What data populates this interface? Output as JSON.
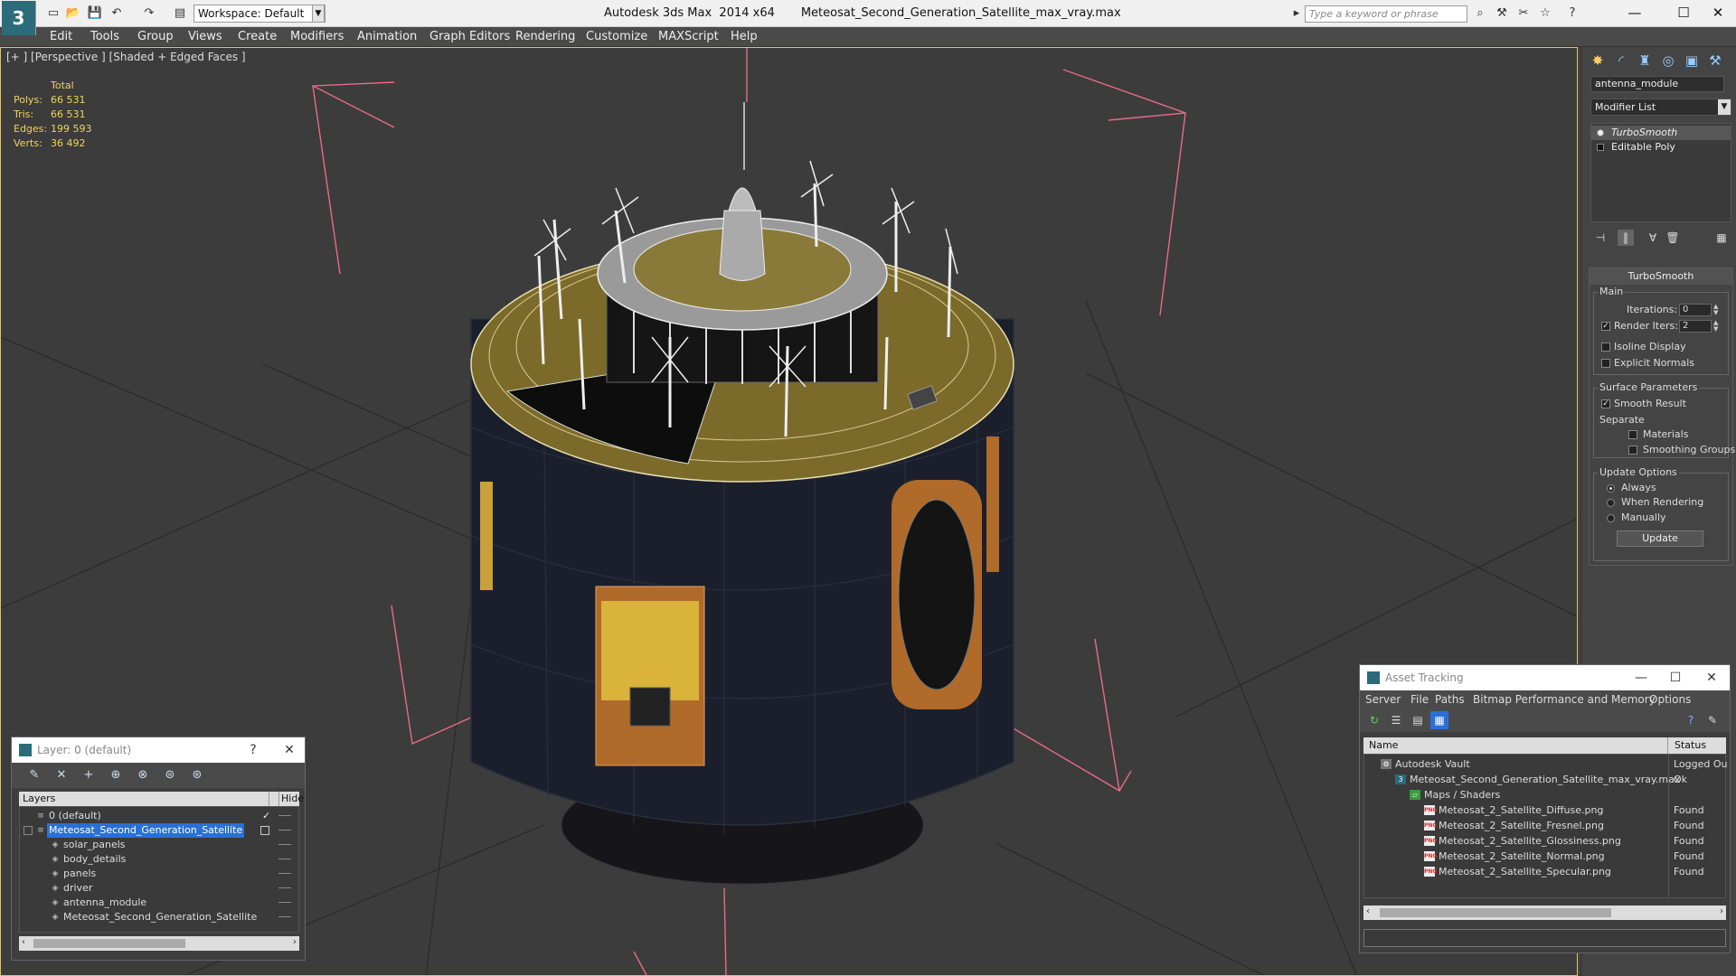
{
  "titlebar": {
    "app_logo": "3",
    "workspace": "Workspace: Default",
    "title": "Autodesk 3ds Max  2014 x64       Meteosat_Second_Generation_Satellite_max_vray.max",
    "search_placeholder": "Type a keyword or phrase",
    "minimize": "—",
    "maximize": "☐",
    "close": "✕"
  },
  "menu": [
    "Edit",
    "Tools",
    "Group",
    "Views",
    "Create",
    "Modifiers",
    "Animation",
    "Graph Editors",
    "Rendering",
    "Customize",
    "MAXScript",
    "Help"
  ],
  "viewport": {
    "label": "[+ ] [Perspective ] [Shaded + Edged Faces ]",
    "stats_header": "Total",
    "stats": [
      {
        "label": "Polys:",
        "value": "66 531"
      },
      {
        "label": "Tris:",
        "value": "66 531"
      },
      {
        "label": "Edges:",
        "value": "199 593"
      },
      {
        "label": "Verts:",
        "value": "36 492"
      }
    ]
  },
  "command_panel": {
    "object_name": "antenna_module",
    "modifier_list": "Modifier List",
    "stack": [
      {
        "label": "TurboSmooth",
        "selected": true
      },
      {
        "label": "Editable Poly",
        "selected": false
      }
    ],
    "rollout_title": "TurboSmooth",
    "main_group": "Main",
    "iterations_label": "Iterations:",
    "iterations_value": "0",
    "render_iters_label": "Render Iters:",
    "render_iters_value": "2",
    "isoline_label": "Isoline Display",
    "explicit_normals_label": "Explicit Normals",
    "surface_group": "Surface Parameters",
    "smooth_result_label": "Smooth Result",
    "separate_label": "Separate",
    "materials_label": "Materials",
    "smoothing_groups_label": "Smoothing Groups",
    "update_group": "Update Options",
    "always_label": "Always",
    "when_rendering_label": "When Rendering",
    "manually_label": "Manually",
    "update_button": "Update"
  },
  "layer_dialog": {
    "title": "Layer: 0 (default)",
    "help": "?",
    "close": "✕",
    "col_layers": "Layers",
    "col_hide": "Hide",
    "rows": [
      {
        "name": "0 (default)",
        "indent": 1,
        "selected": false,
        "check": "✓"
      },
      {
        "name": "Meteosat_Second_Generation_Satellite",
        "indent": 1,
        "selected": true,
        "check": ""
      },
      {
        "name": "solar_panels",
        "indent": 2,
        "selected": false,
        "check": ""
      },
      {
        "name": "body_details",
        "indent": 2,
        "selected": false,
        "check": ""
      },
      {
        "name": "panels",
        "indent": 2,
        "selected": false,
        "check": ""
      },
      {
        "name": "driver",
        "indent": 2,
        "selected": false,
        "check": ""
      },
      {
        "name": "antenna_module",
        "indent": 2,
        "selected": false,
        "check": ""
      },
      {
        "name": "Meteosat_Second_Generation_Satellite",
        "indent": 2,
        "selected": false,
        "check": ""
      }
    ]
  },
  "asset_dialog": {
    "title": "Asset Tracking",
    "minimize": "—",
    "maximize": "☐",
    "close": "✕",
    "menu": [
      "Server",
      "File",
      "Paths",
      "Bitmap Performance and Memory",
      "Options"
    ],
    "col_name": "Name",
    "col_status": "Status",
    "rows": [
      {
        "name": "Autodesk Vault",
        "status": "Logged Ou",
        "indent": 1,
        "icon": "vault"
      },
      {
        "name": "Meteosat_Second_Generation_Satellite_max_vray.max",
        "status": "Ok",
        "indent": 2,
        "icon": "max"
      },
      {
        "name": "Maps / Shaders",
        "status": "",
        "indent": 3,
        "icon": "folder"
      },
      {
        "name": "Meteosat_2_Satellite_Diffuse.png",
        "status": "Found",
        "indent": 4,
        "icon": "png"
      },
      {
        "name": "Meteosat_2_Satellite_Fresnel.png",
        "status": "Found",
        "indent": 4,
        "icon": "png"
      },
      {
        "name": "Meteosat_2_Satellite_Glossiness.png",
        "status": "Found",
        "indent": 4,
        "icon": "png"
      },
      {
        "name": "Meteosat_2_Satellite_Normal.png",
        "status": "Found",
        "indent": 4,
        "icon": "png"
      },
      {
        "name": "Meteosat_2_Satellite_Specular.png",
        "status": "Found",
        "indent": 4,
        "icon": "png"
      }
    ]
  }
}
